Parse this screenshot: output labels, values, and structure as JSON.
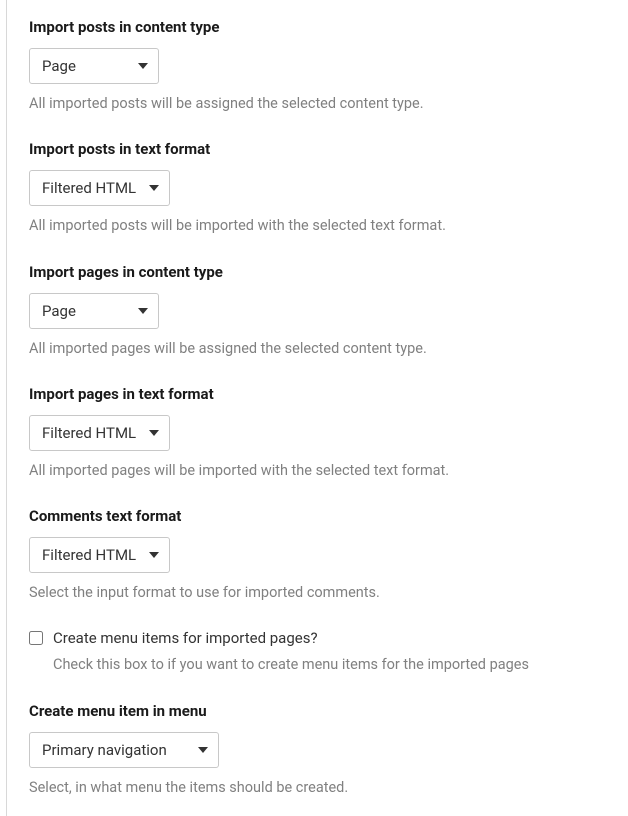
{
  "fields": {
    "posts_content_type": {
      "label": "Import posts in content type",
      "value": "Page",
      "description": "All imported posts will be assigned the selected content type."
    },
    "posts_text_format": {
      "label": "Import posts in text format",
      "value": "Filtered HTML",
      "description": "All imported posts will be imported with the selected text format."
    },
    "pages_content_type": {
      "label": "Import pages in content type",
      "value": "Page",
      "description": "All imported pages will be assigned the selected content type."
    },
    "pages_text_format": {
      "label": "Import pages in text format",
      "value": "Filtered HTML",
      "description": "All imported pages will be imported with the selected text format."
    },
    "comments_text_format": {
      "label": "Comments text format",
      "value": "Filtered HTML",
      "description": "Select the input format to use for imported comments."
    },
    "create_menu_items": {
      "label": "Create menu items for imported pages?",
      "description": "Check this box to if you want to create menu items for the imported pages"
    },
    "menu_item_menu": {
      "label": "Create menu item in menu",
      "value": "Primary navigation",
      "description": "Select, in what menu the items should be created."
    }
  }
}
